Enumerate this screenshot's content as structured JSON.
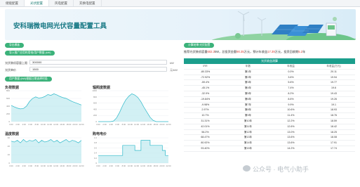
{
  "tabs": [
    {
      "label": "储能配置"
    },
    {
      "label": "光伏配置"
    },
    {
      "label": "风电配置"
    },
    {
      "label": "充换电配置"
    }
  ],
  "banner": {
    "title": "安科瑞微电网光伏容量配置工具"
  },
  "left": {
    "step1_pill": "导出模板",
    "step2_pill": "导入推广应用的用电/用户数据 (kW)",
    "fields": [
      {
        "label": "光伏装机容量上限",
        "value": "300000",
        "unit": "kW"
      },
      {
        "label": "光伏单价",
        "value": "1500",
        "unit": "元/kW"
      }
    ],
    "step3_pill": "用户数据 (kW)根据日期选择时段",
    "charts": {
      "load": {
        "title": "负荷数据",
        "ylabels": [
          "800",
          "600",
          "400",
          "200",
          "0"
        ],
        "xlabels": [
          "0:00",
          "2:00",
          "4:00",
          "6:00",
          "8:00",
          "10:00",
          "12:00",
          "14:00",
          "16:00",
          "18:00",
          "20:00",
          "22:00"
        ],
        "series": [
          420,
          380,
          350,
          330,
          340,
          400,
          520,
          600,
          640,
          610,
          620,
          650,
          700,
          680,
          720,
          690,
          650,
          620,
          600,
          560,
          520,
          490,
          460,
          430
        ]
      },
      "irradiance": {
        "title": "辐照度数据",
        "ylabels": [
          "1000",
          "800",
          "600",
          "400",
          "200",
          "0"
        ],
        "xlabels": [
          "0:00",
          "2:00",
          "4:00",
          "6:00",
          "8:00",
          "10:00",
          "12:00",
          "14:00",
          "16:00",
          "18:00",
          "20:00",
          "22:00"
        ],
        "series": [
          0,
          0,
          0,
          0,
          0,
          20,
          120,
          300,
          520,
          700,
          820,
          900,
          860,
          780,
          640,
          460,
          300,
          140,
          40,
          0,
          0,
          0,
          0,
          0
        ]
      },
      "temperature": {
        "title": "温度数据",
        "ylabels": [
          "30",
          "20",
          "10",
          "0"
        ],
        "xlabels": [
          "0:00",
          "2:00",
          "4:00",
          "6:00",
          "8:00",
          "10:00",
          "12:00",
          "14:00",
          "16:00",
          "18:00",
          "20:00",
          "22:00"
        ],
        "series": [
          26,
          25,
          27,
          24,
          28,
          25,
          27,
          26,
          28,
          24,
          27,
          25,
          26,
          28,
          25,
          27,
          24,
          26,
          28,
          25,
          27,
          26,
          24,
          27
        ]
      },
      "price": {
        "title": "购电电价",
        "ylabels": [
          "1.0",
          "0.8",
          "0.6",
          "0.4",
          "0.2",
          "0"
        ],
        "xlabels": [
          "0:00",
          "2:00",
          "4:00",
          "6:00",
          "8:00",
          "10:00",
          "12:00",
          "14:00",
          "16:00",
          "18:00",
          "20:00",
          "22:00"
        ],
        "series": [
          0.3,
          0.3,
          0.3,
          0.3,
          0.3,
          0.3,
          0.3,
          0.3,
          0.7,
          0.7,
          0.7,
          0.7,
          0.5,
          0.5,
          0.9,
          0.9,
          0.9,
          0.7,
          0.7,
          0.7,
          0.7,
          0.5,
          0.3,
          0.3
        ]
      }
    }
  },
  "right": {
    "pill": "计算结果/光伏配置",
    "result_prefix": "推荐光伏装机容量",
    "result_capacity": "602.3",
    "result_mid1": "kW，总投资金额",
    "result_invest": "90.35",
    "result_mid2": "万元，预计年收益",
    "result_income": "17.39",
    "result_mid3": "万元，投资回收期",
    "result_payback": "5.2",
    "result_suffix": "年",
    "table_title": "光伏收益测算",
    "columns": [
      "IRR",
      "年数",
      "年收益",
      "年收益(万元)"
    ],
    "rows": [
      [
        "-80.33%",
        "第1年",
        "0.0%",
        "20.11"
      ],
      [
        "-72.92%",
        "第2年",
        "3.6%",
        "19.94"
      ],
      [
        "-59.4%",
        "第3年",
        "5.6%",
        "19.77"
      ],
      [
        "-45.1%",
        "第4年",
        "7.4%",
        "19.6"
      ],
      [
        "-32.9%",
        "第5年",
        "8.2%",
        "19.43"
      ],
      [
        "-19.84%",
        "第6年",
        "8.6%",
        "19.26"
      ],
      [
        "-9.98%",
        "第7年",
        "9.9%",
        "19.1"
      ],
      [
        "2.97%",
        "第8年",
        "10.6%",
        "18.93"
      ],
      [
        "10.7%",
        "第9年",
        "11.4%",
        "18.76"
      ],
      [
        "31.31%",
        "第10年",
        "12.2%",
        "18.59"
      ],
      [
        "42.01%",
        "第11年",
        "12.6%",
        "18.42"
      ],
      [
        "56.2%",
        "第12年",
        "13.0%",
        "18.25"
      ],
      [
        "68.47%",
        "第13年",
        "13.6%",
        "18.08"
      ],
      [
        "80.92%",
        "第14年",
        "13.6%",
        "17.91"
      ],
      [
        "93.40%",
        "第15年",
        "14.2%",
        "17.74"
      ]
    ]
  },
  "watermark": {
    "text": "公众号 · 电气小助手"
  },
  "colors": {
    "accent": "#1b9e8c",
    "pill": "#3bb27a",
    "chart_line": "#2bb8c9",
    "chart_fill": "#bfe9ef",
    "red": "#d9362b"
  }
}
